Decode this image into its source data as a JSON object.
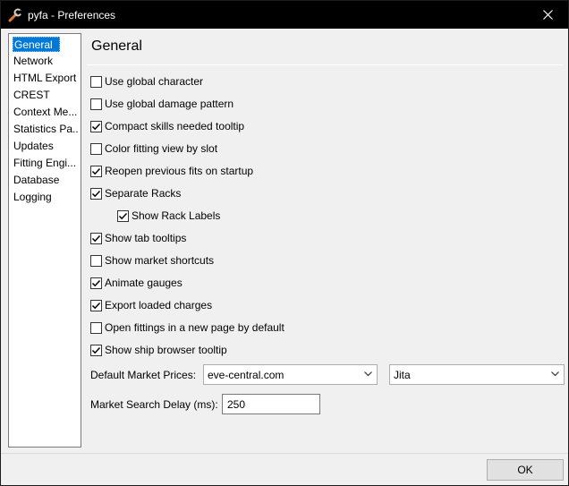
{
  "window": {
    "title": "pyfa - Preferences",
    "app_icon": "wrench-icon"
  },
  "sidebar": {
    "items": [
      {
        "label": "General",
        "selected": true
      },
      {
        "label": "Network"
      },
      {
        "label": "HTML Export"
      },
      {
        "label": "CREST"
      },
      {
        "label": "Context Me..."
      },
      {
        "label": "Statistics Pa..."
      },
      {
        "label": "Updates"
      },
      {
        "label": "Fitting Engi..."
      },
      {
        "label": "Database"
      },
      {
        "label": "Logging"
      }
    ]
  },
  "panel": {
    "title": "General",
    "options": [
      {
        "label": "Use global character",
        "checked": false
      },
      {
        "label": "Use global damage pattern",
        "checked": false
      },
      {
        "label": "Compact skills needed tooltip",
        "checked": true
      },
      {
        "label": "Color fitting view by slot",
        "checked": false
      },
      {
        "label": "Reopen previous fits on startup",
        "checked": true
      },
      {
        "label": "Separate Racks",
        "checked": true
      },
      {
        "label": "Show Rack Labels",
        "checked": true,
        "indented": true
      },
      {
        "label": "Show tab tooltips",
        "checked": true
      },
      {
        "label": "Show market shortcuts",
        "checked": false
      },
      {
        "label": "Animate gauges",
        "checked": true
      },
      {
        "label": "Export loaded charges",
        "checked": true
      },
      {
        "label": "Open fittings in a new page by default",
        "checked": false
      },
      {
        "label": "Show ship browser tooltip",
        "checked": true
      }
    ],
    "market_prices_label": "Default Market Prices:",
    "market_source": "eve-central.com",
    "market_system": "Jita",
    "search_delay_label": "Market Search Delay (ms):",
    "search_delay_value": "250"
  },
  "footer": {
    "ok_label": "OK"
  }
}
